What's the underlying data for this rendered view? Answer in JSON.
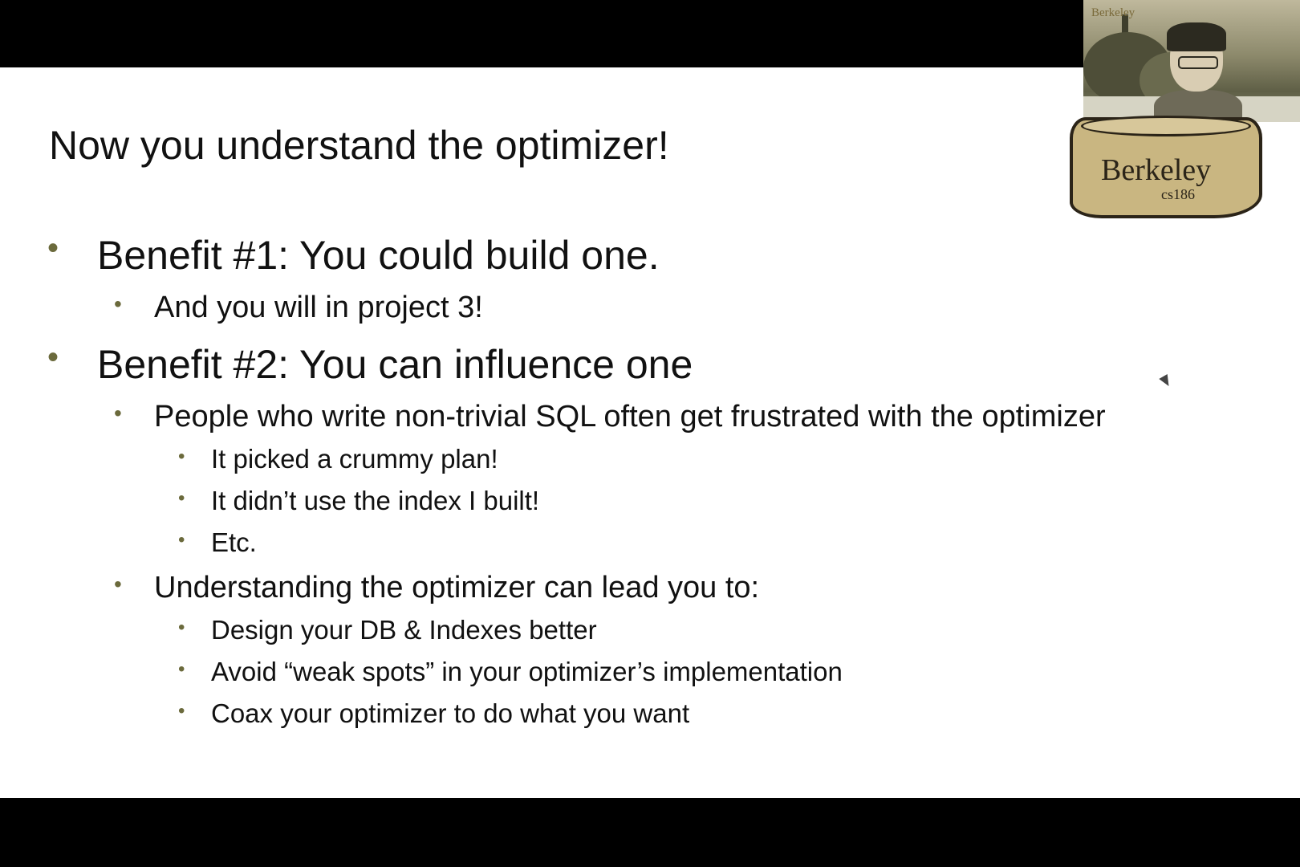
{
  "slide": {
    "title": "Now you understand the optimizer!",
    "bullets": [
      {
        "level": 1,
        "text": "Benefit #1: You could build one."
      },
      {
        "level": 2,
        "text": "And you will in project 3!"
      },
      {
        "level": 1,
        "text": "Benefit #2: You can influence one"
      },
      {
        "level": 2,
        "text": "People who write non-trivial SQL often get frustrated with the optimizer"
      },
      {
        "level": 3,
        "text": "It picked a crummy plan!"
      },
      {
        "level": 3,
        "text": "It didn’t use the index I built!"
      },
      {
        "level": 3,
        "text": "Etc."
      },
      {
        "level": 2,
        "text": "Understanding the optimizer can lead you to:"
      },
      {
        "level": 3,
        "text": "Design your DB & Indexes better"
      },
      {
        "level": 3,
        "text": "Avoid “weak spots” in your optimizer’s implementation"
      },
      {
        "level": 3,
        "text": "Coax your optimizer to do what you want"
      }
    ],
    "bullet_glyph": "•",
    "bullet_color": "#6b6a3c"
  },
  "webcam": {
    "corner_label": "Berkeley"
  },
  "badge": {
    "word": "Berkeley",
    "course": "cs186",
    "color": "#c9b681"
  },
  "icons": {
    "cursor": "mouse-pointer-icon"
  }
}
